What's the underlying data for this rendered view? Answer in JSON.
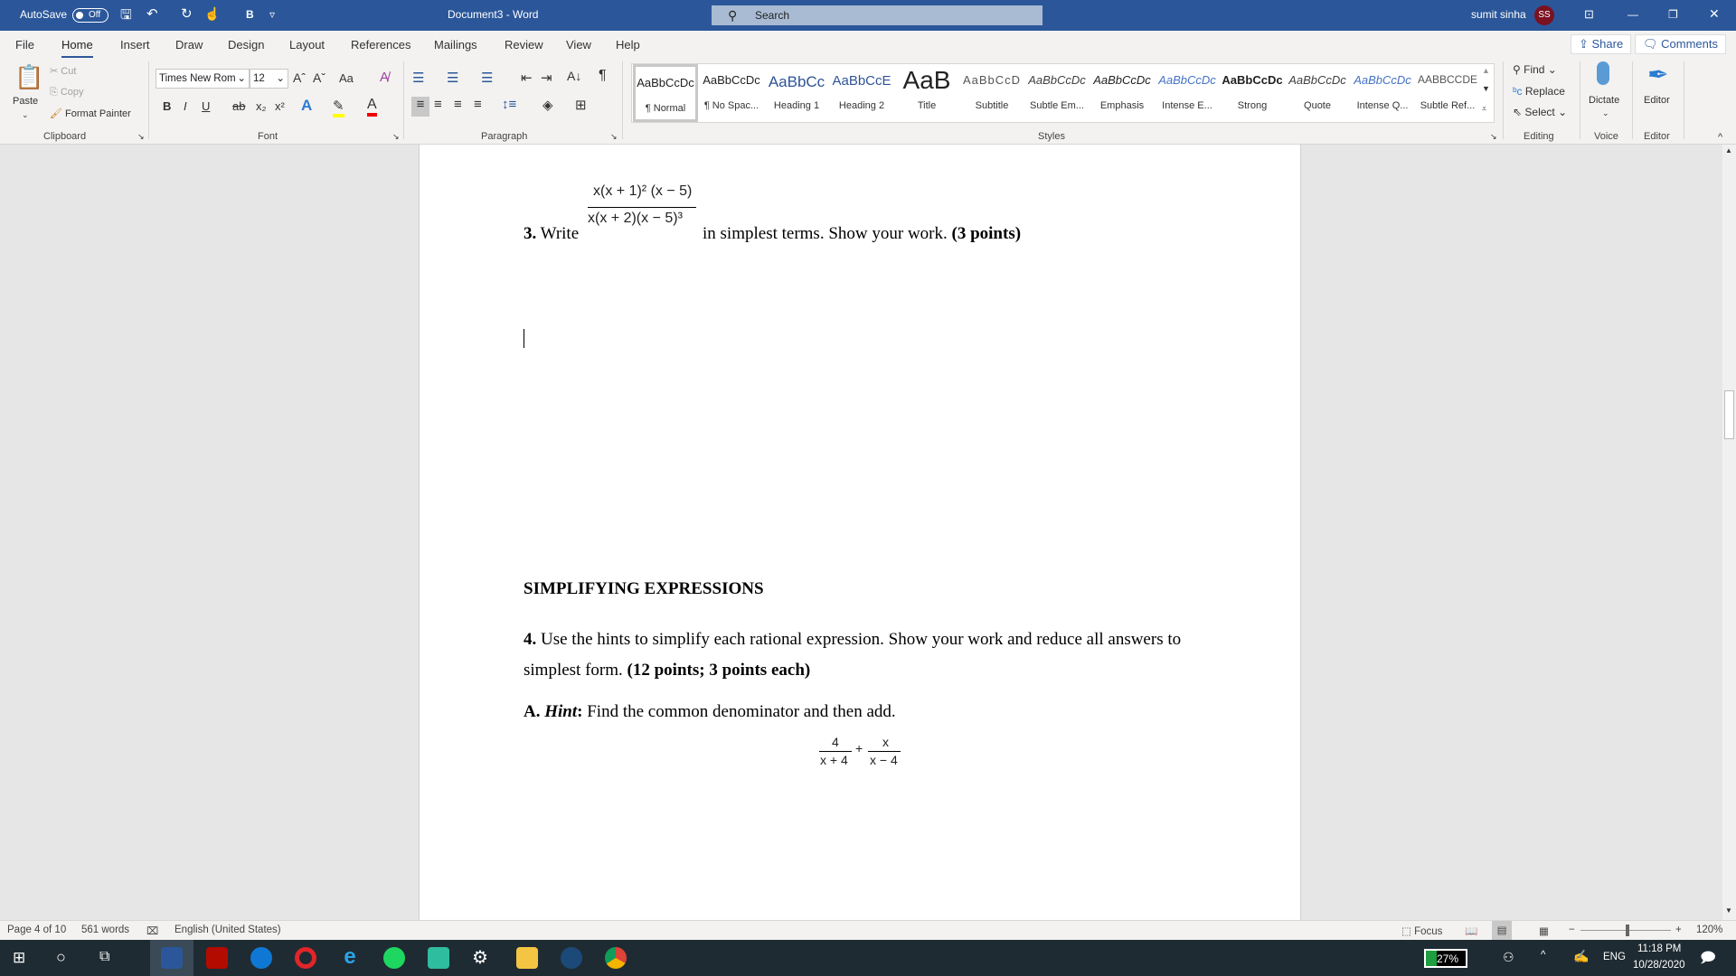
{
  "titlebar": {
    "autosave_label": "AutoSave",
    "autosave_state": "Off",
    "bold_label": "B",
    "document_title": "Document3  -  Word",
    "search_placeholder": "Search",
    "user_name": "sumit sinha",
    "user_initials": "SS",
    "accent": "#2b579a"
  },
  "tabs": [
    {
      "label": "File"
    },
    {
      "label": "Home",
      "active": true
    },
    {
      "label": "Insert"
    },
    {
      "label": "Draw"
    },
    {
      "label": "Design"
    },
    {
      "label": "Layout"
    },
    {
      "label": "References"
    },
    {
      "label": "Mailings"
    },
    {
      "label": "Review"
    },
    {
      "label": "View"
    },
    {
      "label": "Help"
    }
  ],
  "actions": {
    "share": "Share",
    "comments": "Comments"
  },
  "clipboard": {
    "paste": "Paste",
    "cut": "Cut",
    "copy": "Copy",
    "format_painter": "Format Painter",
    "label": "Clipboard"
  },
  "font": {
    "name": "Times New Rom",
    "size": "12",
    "change_case": "Aa",
    "label": "Font",
    "bold": "B",
    "italic": "I",
    "underline": "U",
    "strike": "ab"
  },
  "paragraph": {
    "label": "Paragraph",
    "pilcrow": "¶"
  },
  "styles": {
    "label": "Styles",
    "items": [
      {
        "preview": "AaBbCcDc",
        "name": "¶ Normal",
        "selected": true
      },
      {
        "preview": "AaBbCcDc",
        "name": "¶ No Spac..."
      },
      {
        "preview": "AaBbCc",
        "name": "Heading 1"
      },
      {
        "preview": "AaBbCcE",
        "name": "Heading 2"
      },
      {
        "preview": "AaB",
        "name": "Title"
      },
      {
        "preview": "AaBbCcD",
        "name": "Subtitle"
      },
      {
        "preview": "AaBbCcDc",
        "name": "Subtle Em..."
      },
      {
        "preview": "AaBbCcDc",
        "name": "Emphasis"
      },
      {
        "preview": "AaBbCcDc",
        "name": "Intense E..."
      },
      {
        "preview": "AaBbCcDc",
        "name": "Strong"
      },
      {
        "preview": "AaBbCcDc",
        "name": "Quote"
      },
      {
        "preview": "AaBbCcDc",
        "name": "Intense Q..."
      },
      {
        "preview": "AABBCCDE",
        "name": "Subtle Ref..."
      }
    ]
  },
  "editing": {
    "find": "Find",
    "replace": "Replace",
    "select": "Select",
    "label": "Editing"
  },
  "voice": {
    "dictate": "Dictate",
    "label": "Voice"
  },
  "editor": {
    "button": "Editor",
    "label": "Editor"
  },
  "document": {
    "q3_number": "3.",
    "q3_write": " Write",
    "q3_numerator": "x(x + 1)² (x − 5)",
    "q3_denominator": "x(x + 2)(x − 5)³",
    "q3_rest": "in simplest terms. Show your work.",
    "q3_points": "(3 points)",
    "heading": "SIMPLIFYING EXPRESSIONS",
    "q4_number": "4.",
    "q4_text": " Use the hints to simplify each rational expression. Show your work and reduce all answers to",
    "q4_line2": "simplest form. ",
    "q4_points": "(12 points; 3 points each)",
    "a_label": "A. ",
    "a_hint": "Hint",
    "a_colon": ":",
    "a_text": " Find the common denominator and then add.",
    "expr_num1": "4",
    "expr_den1": "x + 4",
    "expr_plus": "+",
    "expr_num2": "x",
    "expr_den2": "x − 4"
  },
  "status": {
    "page": "Page 4 of 10",
    "words": "561 words",
    "language": "English (United States)",
    "focus": "Focus",
    "zoom": "120%",
    "zoom_percent": 120
  },
  "taskbar": {
    "battery": "27%",
    "battery_level": 27,
    "language": "ENG",
    "time": "11:18 PM",
    "date": "10/28/2020"
  }
}
